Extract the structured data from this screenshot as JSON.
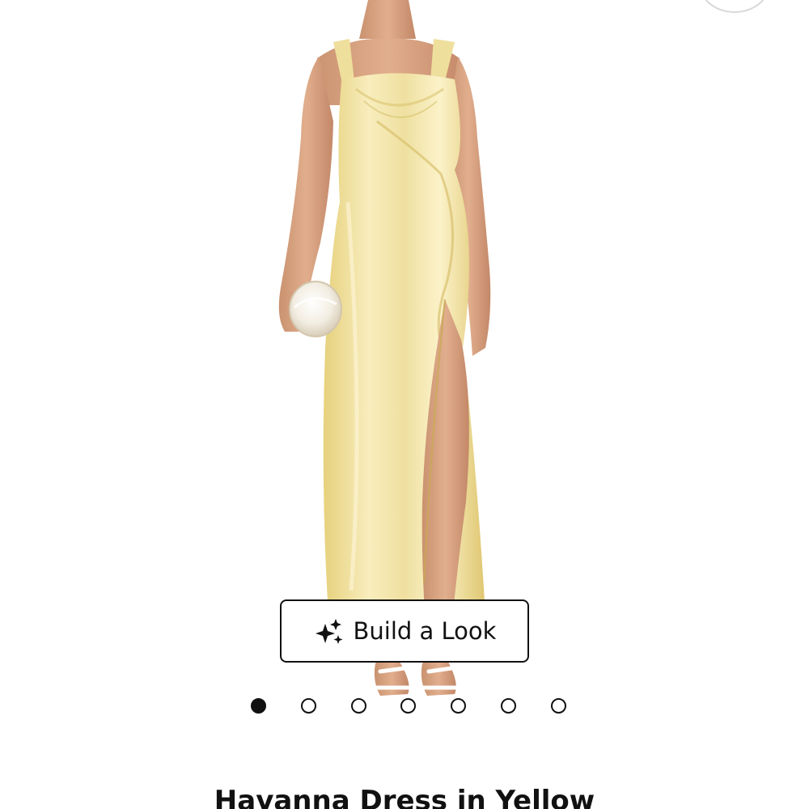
{
  "product": {
    "title": "Havanna Dress in Yellow",
    "dress_color": "#F2E3A1",
    "accent_color": "#111111"
  },
  "gallery": {
    "image_icon": "dress-photo",
    "total_images": 7,
    "active_index": 1
  },
  "build_look": {
    "label": "Build a Look",
    "icon": "sparkle-icon"
  }
}
